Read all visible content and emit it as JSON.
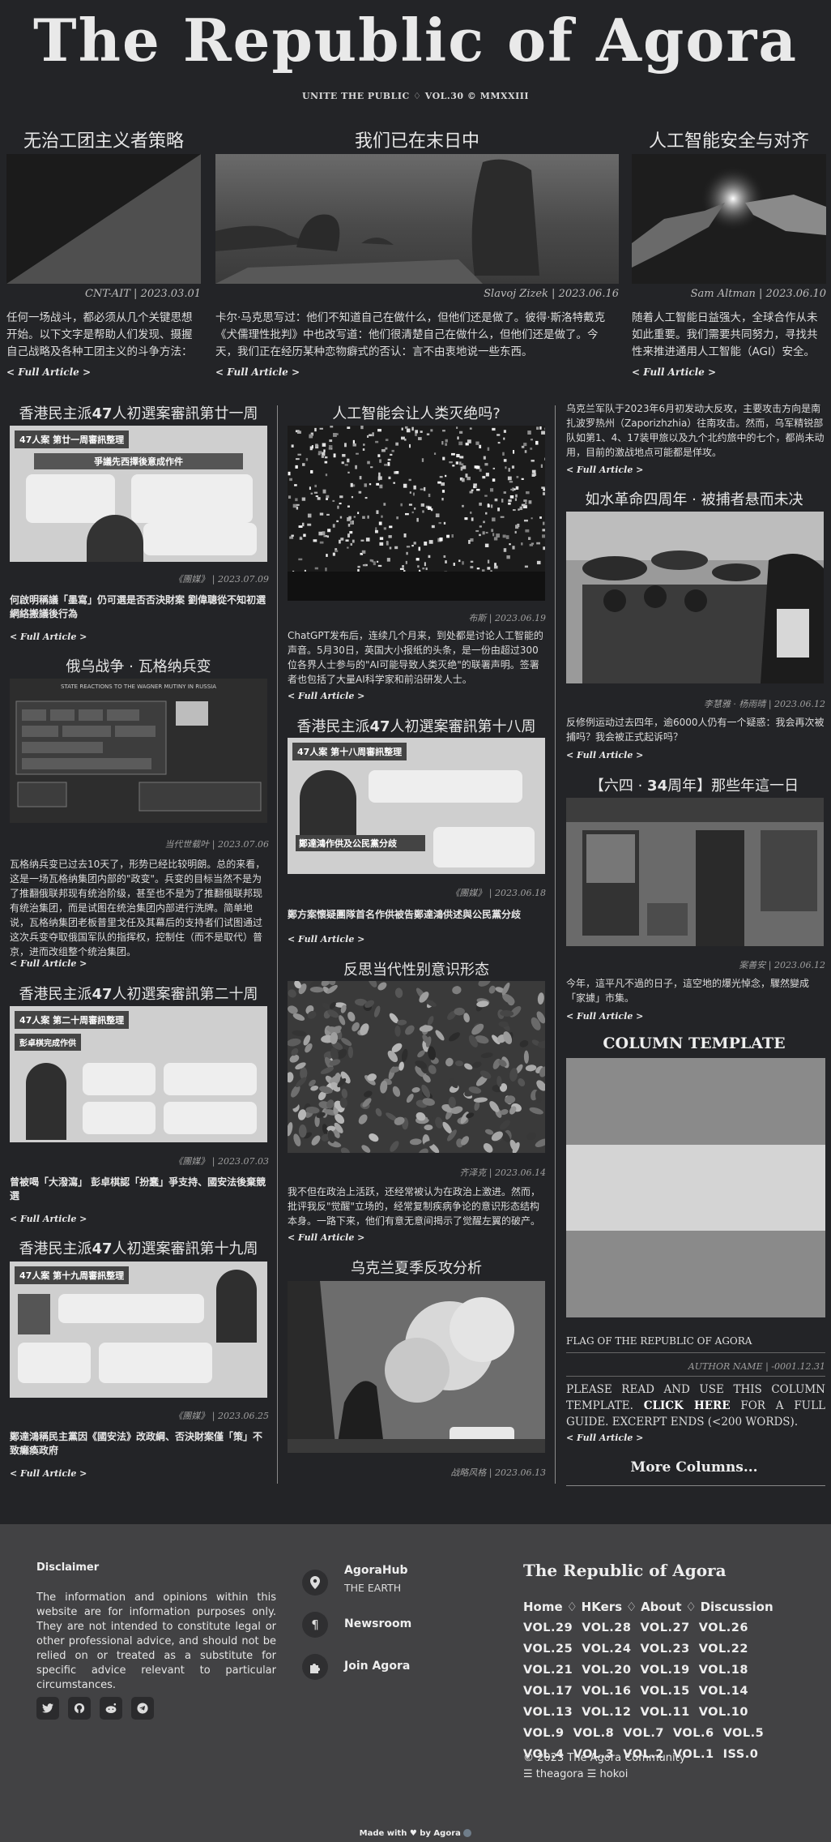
{
  "masthead": {
    "title": "The Republic of Agora",
    "subtitle": "UNITE THE PUBLIC ♢ VOL.30 © MMXXIII"
  },
  "top_articles": [
    {
      "title": "无治工团主义者策略",
      "credit": "CNT-AIT | 2023.03.01",
      "excerpt": "任何一场战斗，都必须从几个关键思想开始。以下文字是帮助人们发现、摄握自己战略及各种工团主义的斗争方法：",
      "full": "< Full Article >"
    },
    {
      "title": "我们已在末日中",
      "credit": "Slavoj Zizek | 2023.06.16",
      "excerpt": "卡尔·马克思写过：他们不知道自己在做什么，但他们还是做了。彼得·斯洛特戴克《犬儒理性批判》中也改写道：他们很清楚自己在做什么，但他们还是做了。今天，我们正在经历某种恋物癖式的否认：言不由衷地说一些东西。",
      "full": "< Full Article >"
    },
    {
      "title": "人工智能安全与对齐",
      "credit": "Sam Altman | 2023.06.10",
      "excerpt": "随着人工智能日益强大，全球合作从未如此重要。我们需要共同努力，寻找共性来推进通用人工智能（AGI）安全。",
      "full": "< Full Article >"
    }
  ],
  "left_column": [
    {
      "title_a": "香港民主派",
      "title_b": "47",
      "title_c": "人初選案審訊第廿一周",
      "poster_head": "47人案 第廿一周審訊整理",
      "poster_sub": "爭議先西擇後意成作件",
      "credit": "《團媒》 | 2023.07.09",
      "excerpt": "何啟明稱議「墨寫」仍可選是否否決財案 劉偉聰從不知初選網絡搬議後行為",
      "full": "< Full Article >"
    },
    {
      "title": "俄乌战争 · 瓦格纳兵变",
      "poster_head": "STATE REACTIONS TO THE WAGNER MUTINY IN RUSSIA",
      "credit": "当代世载叶 | 2023.07.06",
      "excerpt": "瓦格纳兵变已过去10天了，形势已经比较明朗。总的来看，这是一场瓦格纳集团内部的\"政变\"。兵变的目标当然不是为了推翻俄联邦现有统治阶级，甚至也不是为了推翻俄联邦现有统治集团，而是试图在统治集团内部进行洗牌。简单地说，瓦格纳集团老板普里戈任及其幕后的支持者们试图通过这次兵变夺取俄国军队的指挥权，控制住（而不是取代）普京，进而改组整个统治集团。",
      "full": "< Full Article >"
    },
    {
      "title_a": "香港民主派",
      "title_b": "47",
      "title_c": "人初選案審訊第二十周",
      "poster_head": "47人案 第二十周審訊整理",
      "poster_sub": "彭卓棋完成作供",
      "credit": "《團媒》 | 2023.07.03",
      "excerpt": "曾被喝「大潑瀉」 彭卓棋認「扮蠢」爭支持、國安法後棄競選",
      "full": "< Full Article >"
    },
    {
      "title_a": "香港民主派",
      "title_b": "47",
      "title_c": "人初選案審訊第十九周",
      "poster_head": "47人案 第十九周審訊整理",
      "credit": "《團媒》 | 2023.06.25",
      "excerpt": "鄭達鴻稱民主黨因《國安法》改政綱、否決財案僅「策」不致癱瘓政府",
      "full": "< Full Article >"
    }
  ],
  "mid_column": [
    {
      "title": "人工智能会让人类灭绝吗?",
      "credit": "布斯 | 2023.06.19",
      "excerpt": "ChatGPT发布后，连续几个月来，到处都是讨论人工智能的声音。5月30日，英国大小报纸的头条，是一份由超过300位各界人士参与的\"AI可能导致人类灭绝\"的联署声明。签署者也包括了大量AI科学家和前沿研发人士。",
      "full": "< Full Article >"
    },
    {
      "title_a": "香港民主派",
      "title_b": "47",
      "title_c": "人初選案審訊第十八周",
      "poster_head": "47人案 第十八周審訊整理",
      "poster_sub": "鄭達鴻作供及公民黨分歧",
      "credit": "《團媒》 | 2023.06.18",
      "excerpt": "鄭方案懷疑團隊首名作供被告鄭達鴻供述與公民黨分歧",
      "full": "< Full Article >"
    },
    {
      "title": "反思当代性别意识形态",
      "credit": "齐泽克 | 2023.06.14",
      "excerpt": "我不但在政治上活跃，还经常被认为在政治上激进。然而，批评我反\"觉醒\"立场的，经常复制疾病争论的意识形态结构本身。一路下来，他们有意无意间揭示了觉醒左翼的破产。",
      "full": "< Full Article >"
    },
    {
      "title": "乌克兰夏季反攻分析",
      "credit": "战略风格 | 2023.06.13"
    }
  ],
  "right_column": [
    {
      "excerpt": "乌克兰军队于2023年6月初发动大反攻，主要攻击方向是南扎波罗热州（Zaporizhzhia）往南攻击。然而，乌军精锐部队如第1、4、17装甲旅以及九个北约旅中的七个，都尚未动用，目前的激战地点可能都是佯攻。",
      "full": "< Full Article >"
    },
    {
      "title": "如水革命四周年 · 被捕者悬而未决",
      "credit": "李慧雅 · 杨雨晴 | 2023.06.12",
      "excerpt": "反修例运动过去四年，逾6000人仍有一个疑惑：我会再次被捕吗？我会被正式起诉吗？",
      "full": "< Full Article >"
    },
    {
      "title_a": "【六四 · ",
      "title_b": "34",
      "title_c": "周年】那些年這一日",
      "credit": "案善安 | 2023.06.12",
      "excerpt": "今年，這平凡不過的日子，這空地的爆光悼念，驟然變成「家據」市集。",
      "full": "< Full Article >"
    },
    {
      "title": "COLUMN TEMPLATE",
      "caption": "FLAG OF THE REPUBLIC OF AGORA",
      "credit": "AUTHOR NAME | -0001.12.31",
      "excerpt_a": "PLEASE READ AND USE THIS COLUMN TEMPLATE. ",
      "excerpt_b": "CLICK HERE",
      "excerpt_c": " FOR A FULL GUIDE. EXCERPT ENDS (<200 WORDS).",
      "full": "< Full Article >",
      "flag_colors": [
        "#8a8a8a",
        "#d4d4d4",
        "#8a8a8a"
      ]
    },
    {
      "more": "More Columns..."
    }
  ],
  "footer": {
    "disclaimer_title": "Disclaimer",
    "disclaimer_text": "The information and opinions within this website are for information purposes only. They are not intended to constitute legal or other professional advice, and should not be relied on or treated as a substitute for specific advice relevant to particular circumstances.",
    "social_icons": [
      "twitter-icon",
      "github-icon",
      "reddit-icon",
      "telegram-icon"
    ],
    "links": [
      {
        "label": "AgoraHub",
        "sub": "THE EARTH",
        "icon": "map-pin-icon"
      },
      {
        "label": "Newsroom",
        "icon": "paragraph-icon"
      },
      {
        "label": "Join Agora",
        "icon": "puzzle-icon"
      }
    ],
    "brand": "The Republic of Agora",
    "nav": [
      "Home",
      "HKers",
      "About",
      "Discussion"
    ],
    "nav_sep": "♢",
    "vols": [
      "VOL.29",
      "VOL.28",
      "VOL.27",
      "VOL.26",
      "VOL.25",
      "VOL.24",
      "VOL.23",
      "VOL.22",
      "VOL.21",
      "VOL.20",
      "VOL.19",
      "VOL.18",
      "VOL.17",
      "VOL.16",
      "VOL.15",
      "VOL.14",
      "VOL.13",
      "VOL.12",
      "VOL.11",
      "VOL.10",
      "VOL.9",
      "VOL.8",
      "VOL.7",
      "VOL.6",
      "VOL.5",
      "VOL.4",
      "VOL.3",
      "VOL.2",
      "VOL.1",
      "ISS.0"
    ],
    "copyright": "© 2023 The Agora Community",
    "handles": "☰ theagora ☰ hokoi",
    "made_with_a": "Made with",
    "made_with_b": "by Agora"
  }
}
